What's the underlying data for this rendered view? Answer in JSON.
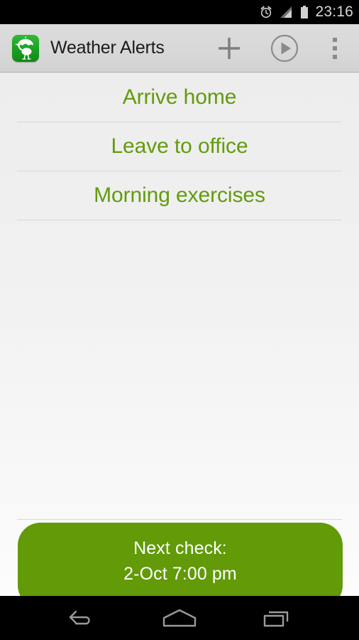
{
  "status_bar": {
    "time": "23:16",
    "icons": [
      "alarm-clock-icon",
      "signal-bars-icon",
      "battery-icon"
    ],
    "background": "#000000",
    "text_color": "#d8d8d8"
  },
  "action_bar": {
    "app_icon_name": "ostrich-umbrella-app-icon",
    "title": "Weather Alerts",
    "buttons": [
      {
        "name": "add-button",
        "icon": "plus-icon",
        "label": "Add"
      },
      {
        "name": "run-button",
        "icon": "play-circle-icon",
        "label": "Run"
      },
      {
        "name": "overflow-menu-button",
        "icon": "more-vertical-icon",
        "label": "More options"
      }
    ],
    "background": "#d8d8d8",
    "title_color": "#1b1b1b"
  },
  "list": {
    "accent_color": "#629b0d",
    "items": [
      {
        "label": "Arrive home"
      },
      {
        "label": "Leave to office"
      },
      {
        "label": "Morning exercises"
      }
    ]
  },
  "next_check": {
    "title": "Next check:",
    "value": "2-Oct 7:00 pm",
    "background": "#629a08",
    "text_color": "#ffffff"
  },
  "nav_bar": {
    "buttons": [
      {
        "name": "back-button",
        "icon": "back-arrow-icon",
        "label": "Back"
      },
      {
        "name": "home-button",
        "icon": "home-icon",
        "label": "Home"
      },
      {
        "name": "recents-button",
        "icon": "recent-apps-icon",
        "label": "Recent apps"
      }
    ],
    "background": "#000000"
  }
}
